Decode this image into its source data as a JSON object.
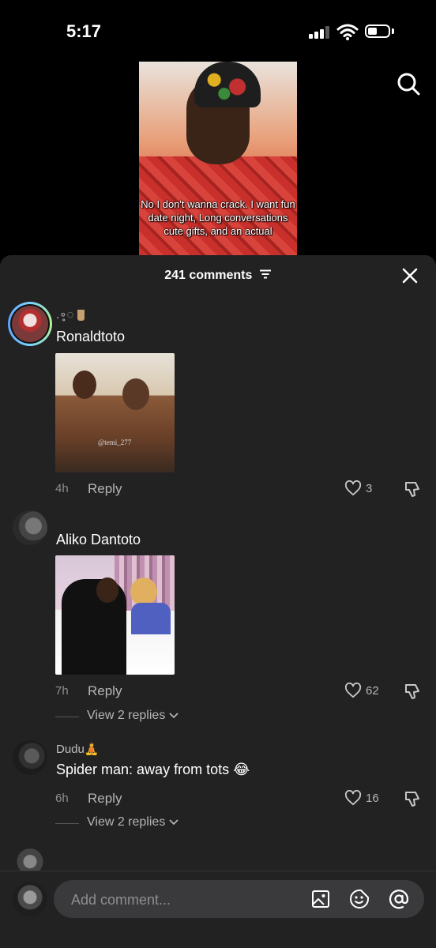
{
  "status": {
    "time": "5:17"
  },
  "video": {
    "caption": "No I don't wanna crack. I want fun date night, Long conversations cute gifts, and an actual"
  },
  "sheet": {
    "title": "241 comments"
  },
  "comments": [
    {
      "name_line": ".∘̥◌",
      "username": "Ronaldtoto",
      "time": "4h",
      "reply": "Reply",
      "likes": "3",
      "image_watermark": "@temi_277"
    },
    {
      "username": "Aliko Dantoto",
      "time": "7h",
      "reply": "Reply",
      "likes": "62",
      "view_replies": "View 2 replies"
    },
    {
      "username": "Dudu🧘",
      "text": "Spider man: away from tots 😂",
      "time": "6h",
      "reply": "Reply",
      "likes": "16",
      "view_replies": "View 2 replies"
    }
  ],
  "input": {
    "placeholder": "Add comment..."
  },
  "icons": [
    "signal-icon",
    "wifi-icon",
    "battery-icon",
    "search-icon",
    "filter-icon",
    "close-icon",
    "heart-icon",
    "dislike-icon",
    "chevron-down-icon",
    "image-icon",
    "emoji-icon",
    "mention-icon"
  ]
}
